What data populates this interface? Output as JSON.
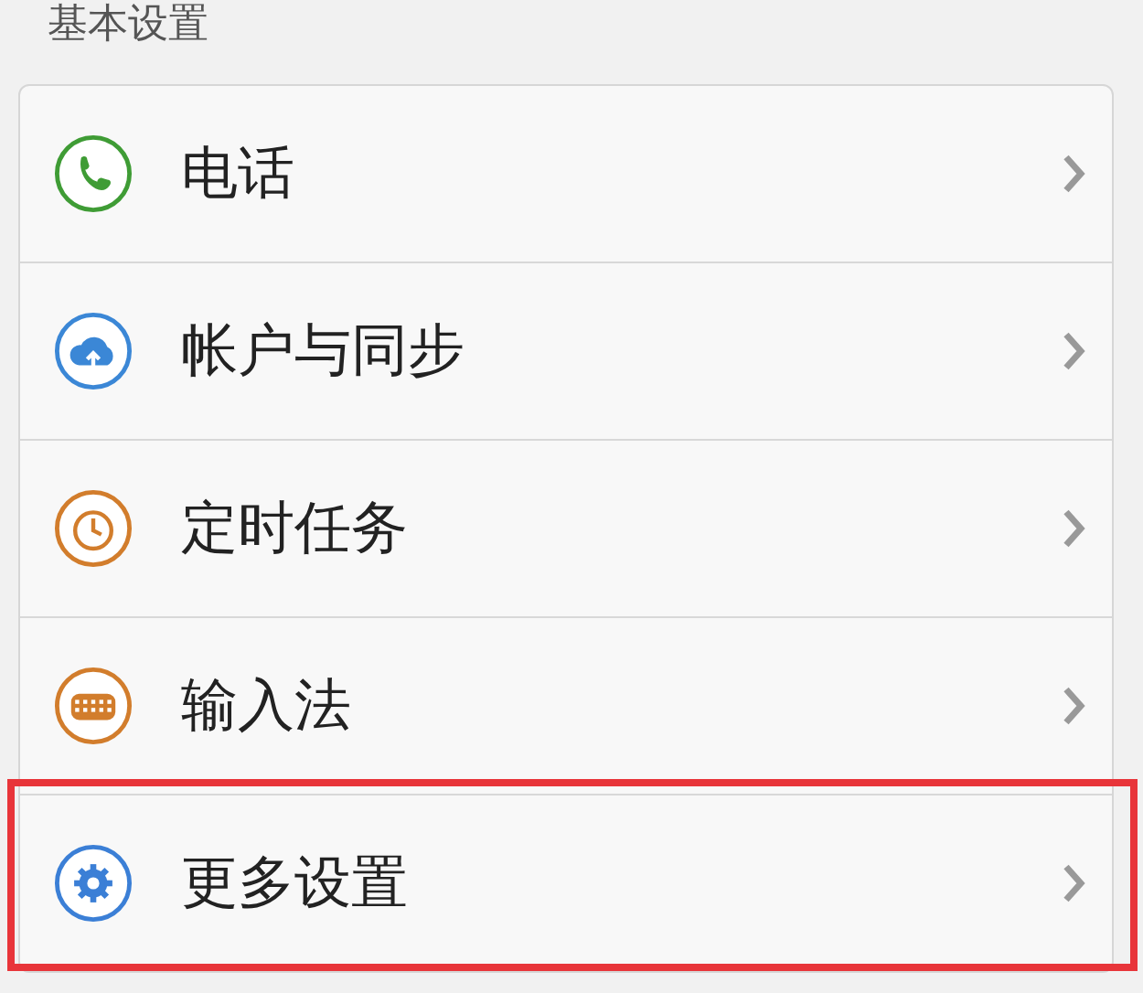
{
  "section_title": "基本设置",
  "items": [
    {
      "label": "电话",
      "kind": "phone",
      "highlighted": false
    },
    {
      "label": "帐户与同步",
      "kind": "cloud",
      "highlighted": false
    },
    {
      "label": "定时任务",
      "kind": "clock",
      "highlighted": false
    },
    {
      "label": "输入法",
      "kind": "keyboard",
      "highlighted": false
    },
    {
      "label": "更多设置",
      "kind": "gear",
      "highlighted": true
    }
  ]
}
